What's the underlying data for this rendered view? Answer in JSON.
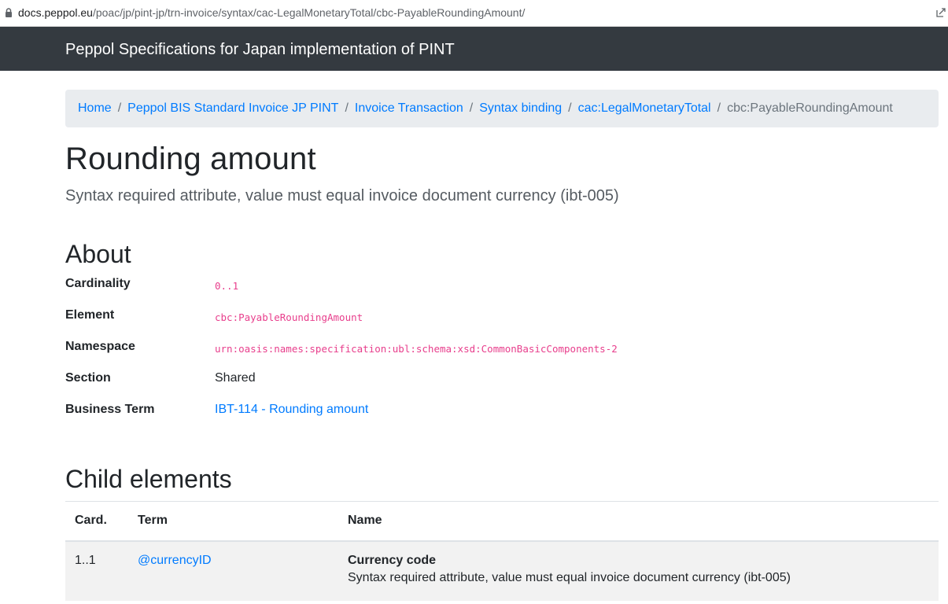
{
  "browser": {
    "url_host": "docs.peppol.eu",
    "url_path": "/poac/jp/pint-jp/trn-invoice/syntax/cac-LegalMonetaryTotal/cbc-PayableRoundingAmount/"
  },
  "navbar": {
    "brand": "Peppol Specifications for Japan implementation of PINT"
  },
  "breadcrumb": [
    {
      "label": "Home"
    },
    {
      "label": "Peppol BIS Standard Invoice JP PINT"
    },
    {
      "label": "Invoice Transaction"
    },
    {
      "label": "Syntax binding"
    },
    {
      "label": "cac:LegalMonetaryTotal"
    },
    {
      "label": "cbc:PayableRoundingAmount"
    }
  ],
  "page": {
    "title": "Rounding amount",
    "lead": "Syntax required attribute, value must equal invoice document currency (ibt-005)"
  },
  "about": {
    "heading": "About",
    "rows": [
      {
        "term": "Cardinality",
        "value": "0..1"
      },
      {
        "term": "Element",
        "value": "cbc:PayableRoundingAmount"
      },
      {
        "term": "Namespace",
        "value": "urn:oasis:names:specification:ubl:schema:xsd:CommonBasicComponents-2"
      },
      {
        "term": "Section",
        "value": "Shared"
      },
      {
        "term": "Business Term",
        "value": "IBT-114 - Rounding amount"
      }
    ]
  },
  "child_elements": {
    "heading": "Child elements",
    "columns": [
      "Card.",
      "Term",
      "Name"
    ],
    "rows": [
      {
        "card": "1..1",
        "term": "@currencyID",
        "name": "Currency code",
        "description": "Syntax required attribute, value must equal invoice document currency (ibt-005)"
      }
    ]
  },
  "colors": {
    "navbar_bg": "#343a40",
    "link": "#007bff",
    "code": "#e83e8c",
    "breadcrumb_bg": "#e9ecef"
  }
}
